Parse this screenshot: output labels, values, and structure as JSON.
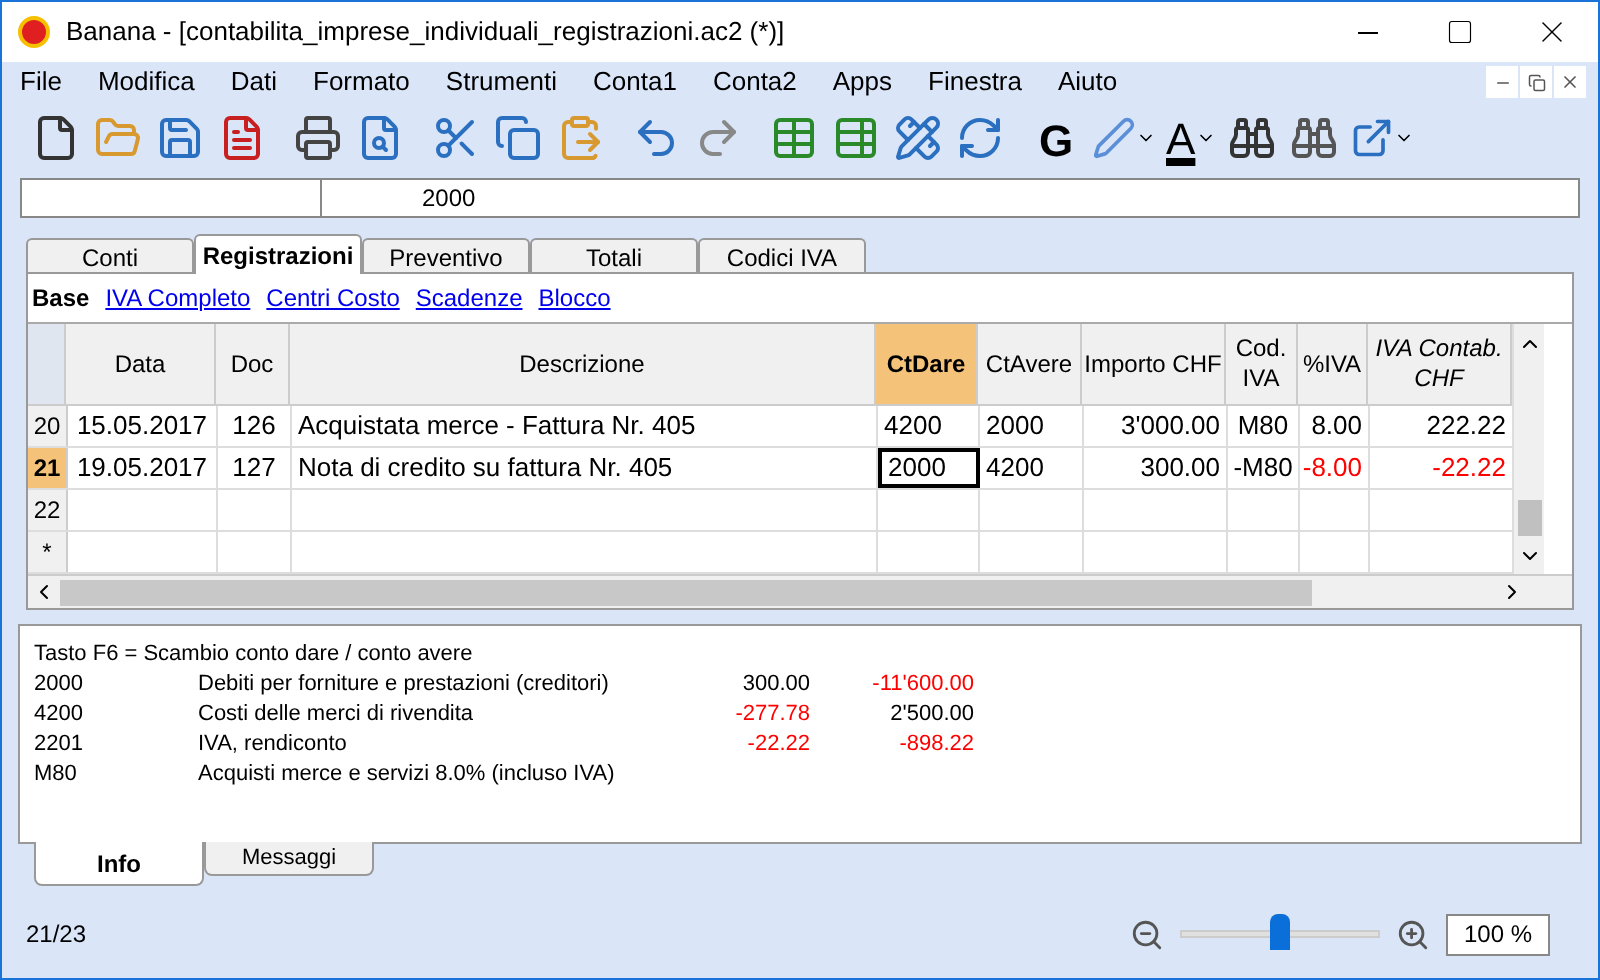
{
  "window": {
    "title": "Banana - [contabilita_imprese_individuali_registrazioni.ac2 (*)]"
  },
  "menu": [
    "File",
    "Modifica",
    "Dati",
    "Formato",
    "Strumenti",
    "Conta1",
    "Conta2",
    "Apps",
    "Finestra",
    "Aiuto"
  ],
  "toolbar": {
    "bold_label": "G",
    "font_color_label": "A"
  },
  "formula_bar": {
    "value": "2000"
  },
  "tabs": [
    {
      "label": "Conti",
      "selected": false
    },
    {
      "label": "Registrazioni",
      "selected": true
    },
    {
      "label": "Preventivo",
      "selected": false
    },
    {
      "label": "Totali",
      "selected": false
    },
    {
      "label": "Codici IVA",
      "selected": false
    }
  ],
  "views": [
    {
      "label": "Base",
      "selected": true
    },
    {
      "label": "IVA Completo",
      "selected": false
    },
    {
      "label": "Centri Costo",
      "selected": false
    },
    {
      "label": "Scadenze",
      "selected": false
    },
    {
      "label": "Blocco",
      "selected": false
    }
  ],
  "table": {
    "columns": [
      {
        "label": "Data",
        "selected": false
      },
      {
        "label": "Doc",
        "selected": false
      },
      {
        "label": "Descrizione",
        "selected": false
      },
      {
        "label": "CtDare",
        "selected": true
      },
      {
        "label": "CtAvere",
        "selected": false
      },
      {
        "label": "Importo CHF",
        "selected": false
      },
      {
        "label": "Cod. IVA",
        "selected": false
      },
      {
        "label": "%IVA",
        "selected": false
      },
      {
        "label": "IVA Contab. CHF",
        "selected": false
      }
    ],
    "rows": [
      {
        "number": "20",
        "selected": false,
        "cells": [
          {
            "text": "15.05.2017",
            "negative": false,
            "active": false
          },
          {
            "text": "126",
            "negative": false,
            "active": false
          },
          {
            "text": "Acquistata merce - Fattura Nr. 405",
            "negative": false,
            "active": false
          },
          {
            "text": "4200",
            "negative": false,
            "active": false
          },
          {
            "text": "2000",
            "negative": false,
            "active": false
          },
          {
            "text": "3'000.00",
            "negative": false,
            "active": false
          },
          {
            "text": "M80",
            "negative": false,
            "active": false
          },
          {
            "text": "8.00",
            "negative": false,
            "active": false
          },
          {
            "text": "222.22",
            "negative": false,
            "active": false
          }
        ]
      },
      {
        "number": "21",
        "selected": true,
        "cells": [
          {
            "text": "19.05.2017",
            "negative": false,
            "active": false
          },
          {
            "text": "127",
            "negative": false,
            "active": false
          },
          {
            "text": "Nota di credito su fattura Nr. 405",
            "negative": false,
            "active": false
          },
          {
            "text": "2000",
            "negative": false,
            "active": true
          },
          {
            "text": "4200",
            "negative": false,
            "active": false
          },
          {
            "text": "300.00",
            "negative": false,
            "active": false
          },
          {
            "text": "-M80",
            "negative": false,
            "active": false
          },
          {
            "text": "-8.00",
            "negative": true,
            "active": false
          },
          {
            "text": "-22.22",
            "negative": true,
            "active": false
          }
        ]
      },
      {
        "number": "22",
        "selected": false
      },
      {
        "number": "*",
        "selected": false
      }
    ]
  },
  "info": {
    "hint": "Tasto F6 = Scambio conto dare / conto avere",
    "lines": [
      {
        "code": "2000",
        "text": "Debiti per forniture e prestazioni (creditori)",
        "amount_1": {
          "text": "300.00",
          "negative": false
        },
        "amount_2": {
          "text": "-11'600.00",
          "negative": true
        }
      },
      {
        "code": "4200",
        "text": "Costi delle merci di rivendita",
        "amount_1": {
          "text": "-277.78",
          "negative": true
        },
        "amount_2": {
          "text": "2'500.00",
          "negative": false
        }
      },
      {
        "code": "2201",
        "text": "IVA, rendiconto",
        "amount_1": {
          "text": "-22.22",
          "negative": true
        },
        "amount_2": {
          "text": "-898.22",
          "negative": true
        }
      },
      {
        "code": "M80",
        "text": "Acquisti merce e servizi 8.0% (incluso IVA)"
      }
    ]
  },
  "panel_tabs": [
    {
      "label": "Info",
      "selected": true
    },
    {
      "label": "Messaggi",
      "selected": false
    }
  ],
  "status_bar": {
    "position": "21/23",
    "zoom": {
      "level": 0.5,
      "value": "100 %"
    }
  }
}
